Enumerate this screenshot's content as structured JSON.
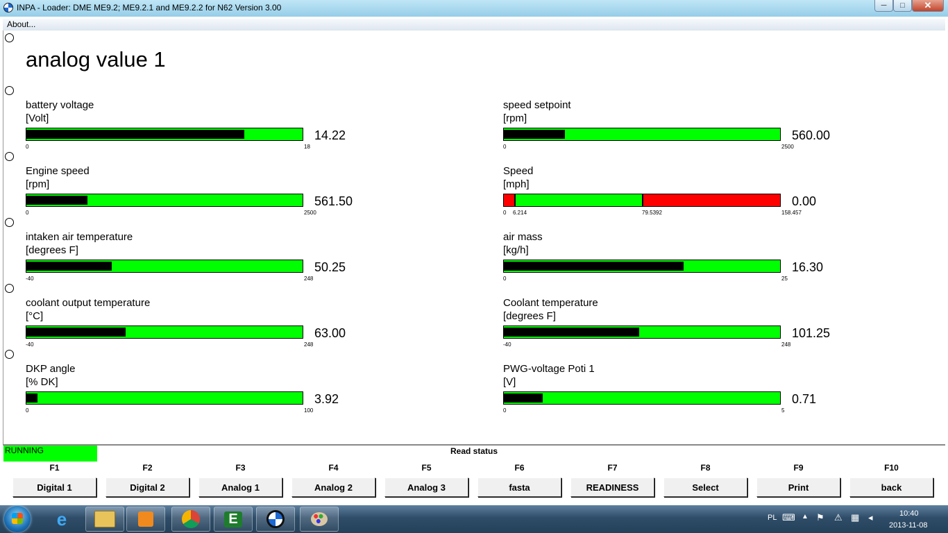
{
  "window": {
    "title": "INPA - Loader:  DME ME9.2; ME9.2.1 and ME9.2.2 for N62 Version 3.00"
  },
  "menu": {
    "about": "About..."
  },
  "page": {
    "heading": "analog value 1"
  },
  "gauges_left": [
    {
      "name": "battery voltage",
      "unit": "[Volt]",
      "value": "14.22",
      "min": "0",
      "max": "18",
      "level": 0.79
    },
    {
      "name": "Engine speed",
      "unit": "[rpm]",
      "value": "561.50",
      "min": "0",
      "max": "2500",
      "level": 0.22
    },
    {
      "name": "intaken air temperature",
      "unit": "[degrees F]",
      "value": "50.25",
      "min": "-40",
      "max": "248",
      "level": 0.31
    },
    {
      "name": "coolant output temperature",
      "unit": "[°C]",
      "value": "63.00",
      "min": "-40",
      "max": "248",
      "level": 0.36
    },
    {
      "name": "DKP angle",
      "unit": "[% DK]",
      "value": "3.92",
      "min": "0",
      "max": "100",
      "level": 0.04
    }
  ],
  "gauges_right": [
    {
      "name": "speed setpoint",
      "unit": "[rpm]",
      "value": "560.00",
      "min": "0",
      "max": "2500",
      "level": 0.22
    },
    {
      "name": "Speed",
      "unit": "[mph]",
      "value": "0.00",
      "min": "0",
      "low": "6.214",
      "high": "79.5392",
      "max": "158.457",
      "level": 0.0
    },
    {
      "name": "air mass",
      "unit": "[kg/h]",
      "value": "16.30",
      "min": "0",
      "max": "25",
      "level": 0.65
    },
    {
      "name": "Coolant temperature",
      "unit": "[degrees F]",
      "value": "101.25",
      "min": "-40",
      "max": "248",
      "level": 0.49
    },
    {
      "name": "PWG-voltage Poti 1",
      "unit": "[V]",
      "value": "0.71",
      "min": "0",
      "max": "5",
      "level": 0.14
    }
  ],
  "status": {
    "running": "RUNNING",
    "read_status": "Read status"
  },
  "function_keys": [
    {
      "key": "F1",
      "label": "Digital 1"
    },
    {
      "key": "F2",
      "label": "Digital 2"
    },
    {
      "key": "F3",
      "label": "Analog 1"
    },
    {
      "key": "F4",
      "label": "Analog 2"
    },
    {
      "key": "F5",
      "label": "Analog 3"
    },
    {
      "key": "F6",
      "label": "fasta"
    },
    {
      "key": "F7",
      "label": "READINESS"
    },
    {
      "key": "F8",
      "label": "Select"
    },
    {
      "key": "F9",
      "label": "Print"
    },
    {
      "key": "F10",
      "label": "back"
    }
  ],
  "taskbar": {
    "language": "PL",
    "time": "10:40",
    "date": "2013-11-08"
  },
  "colors": {
    "bar_ok": "#00ff00",
    "bar_alarm": "#ff0000",
    "bar_fill": "#000000",
    "running": "#00ff00"
  }
}
